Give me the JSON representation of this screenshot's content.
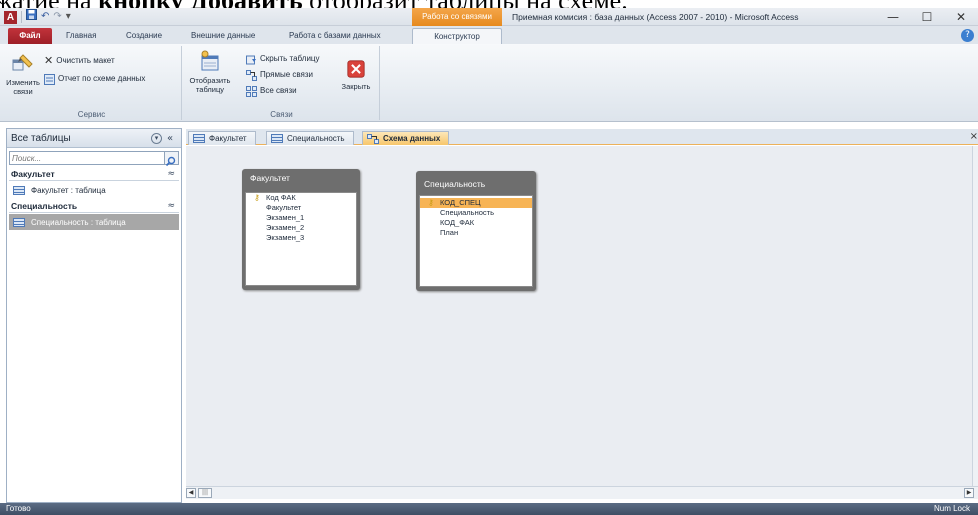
{
  "doc_text": {
    "prefix": "жатие на ",
    "bold": "кнопку Добавить",
    "suffix": " отобразит таблицы на схеме."
  },
  "title_bar": {
    "context_tab": "Работа со связями",
    "window_title": "Приемная комисия : база данных (Access 2007 - 2010)  -  Microsoft Access",
    "minimize": "—",
    "maximize": "☐",
    "close": "✕"
  },
  "ribbon_tabs": {
    "file": "Файл",
    "home": "Главная",
    "create": "Создание",
    "external": "Внешние данные",
    "database": "Работа с базами данных",
    "design": "Конструктор"
  },
  "ribbon": {
    "edit_relationships": "Изменить связи",
    "clear_layout": "Очистить макет",
    "relationship_report": "Отчет по схеме данных",
    "service_group": "Сервис",
    "show_table": "Отобразить таблицу",
    "hide_table": "Скрыть таблицу",
    "direct_relationships": "Прямые связи",
    "all_relationships": "Все связи",
    "close": "Закрыть",
    "relationships_group": "Связи"
  },
  "nav_pane": {
    "title": "Все таблицы",
    "search_placeholder": "Поиск...",
    "groups": [
      {
        "name": "Факультет",
        "item": "Факультет : таблица"
      },
      {
        "name": "Специальность",
        "item": "Специальность : таблица"
      }
    ]
  },
  "doc_tabs": [
    "Факультет",
    "Специальность",
    "Схема данных"
  ],
  "schema": {
    "tables": [
      {
        "name": "Факультет",
        "fields": [
          "Код ФАК",
          "Факультет",
          "Экзамен_1",
          "Экзамен_2",
          "Экзамен_3"
        ],
        "key_field": "Код ФАК"
      },
      {
        "name": "Специальность",
        "fields": [
          "КОД_СПЕЦ",
          "Специальность",
          "КОД_ФАК",
          "План"
        ],
        "key_field": "КОД_СПЕЦ",
        "selected_field": "КОД_СПЕЦ"
      }
    ]
  },
  "status": {
    "left": "Готово",
    "right": "Num Lock"
  },
  "colors": {
    "file_tab": "#a8242c",
    "context": "#e68a1f",
    "status": "#3f4e64",
    "selection": "#f7b455"
  }
}
